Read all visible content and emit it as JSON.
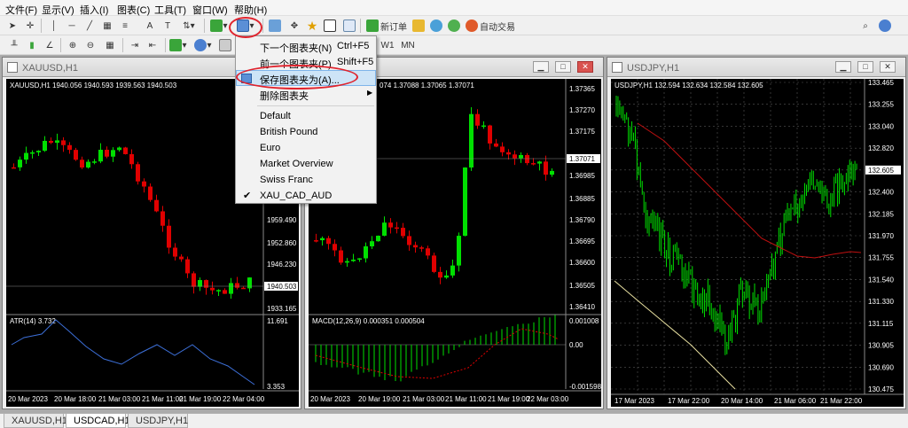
{
  "menubar": {
    "items": [
      "文件(F)",
      "显示(V)",
      "插入(I)",
      "图表(C)",
      "工具(T)",
      "窗口(W)",
      "帮助(H)"
    ]
  },
  "toolbar": {
    "new_order": "新订单",
    "auto_trade": "自动交易",
    "timeframes": [
      "W1",
      "MN"
    ]
  },
  "windows": {
    "xauusd": {
      "title": "XAUUSD,H1",
      "header": "XAUUSD,H1  1940.056 1940.593 1939.563 1940.503",
      "price_labels": [
        "1959.490",
        "1952.860",
        "1946.230",
        "1940.503",
        "1933.165"
      ],
      "indicator": "ATR(14) 3.732",
      "ind_labels": [
        "11.691",
        "3.353"
      ],
      "time_labels": [
        "20 Mar 2023",
        "20 Mar 18:00",
        "21 Mar 03:00",
        "21 Mar 11:00",
        "21 Mar 19:00",
        "22 Mar 04:00"
      ]
    },
    "usdcad": {
      "title": "USDCAD,H1",
      "header": "074 1.37088 1.37065 1.37071",
      "price_labels": [
        "1.37365",
        "1.37270",
        "1.37175",
        "1.37071",
        "1.36985",
        "1.36885",
        "1.36790",
        "1.36695",
        "1.36600",
        "1.36505",
        "1.36410"
      ],
      "indicator": "MACD(12,26,9) 0.000351 0.000504",
      "ind_labels": [
        "0.001008",
        "0.00",
        "-0.001598"
      ],
      "time_labels": [
        "20 Mar 2023",
        "20 Mar 19:00",
        "21 Mar 03:00",
        "21 Mar 11:00",
        "21 Mar 19:00",
        "22 Mar 03:00"
      ]
    },
    "usdjpy": {
      "title": "USDJPY,H1",
      "header": "USDJPY,H1  132.594 132.634 132.584 132.605",
      "price_labels": [
        "133.465",
        "133.255",
        "133.040",
        "132.820",
        "132.605",
        "132.400",
        "132.185",
        "131.970",
        "131.755",
        "131.540",
        "131.330",
        "131.115",
        "130.905",
        "130.690",
        "130.475"
      ],
      "time_labels": [
        "17 Mar 2023",
        "17 Mar 22:00",
        "20 Mar 14:00",
        "21 Mar 06:00",
        "21 Mar 22:00"
      ]
    }
  },
  "context_menu": {
    "items": [
      {
        "label": "下一个图表夹(N)",
        "shortcut": "Ctrl+F5"
      },
      {
        "label": "前一个图表夹(P)",
        "shortcut": "Shift+F5"
      },
      {
        "label": "保存图表夹为(A)...",
        "shortcut": ""
      },
      {
        "label": "删除图表夹",
        "shortcut": ""
      },
      {
        "label": "Default",
        "shortcut": ""
      },
      {
        "label": "British Pound",
        "shortcut": ""
      },
      {
        "label": "Euro",
        "shortcut": ""
      },
      {
        "label": "Market Overview",
        "shortcut": ""
      },
      {
        "label": "Swiss Franc",
        "shortcut": ""
      },
      {
        "label": "XAU_CAD_AUD",
        "shortcut": ""
      }
    ]
  },
  "tabs": [
    "XAUUSD,H1",
    "USDCAD,H1",
    "USDJPY,H1"
  ],
  "colors": {
    "bull": "#00e000",
    "bear": "#e00000",
    "atr": "#3c6fd8",
    "jpy_ma_red": "#c01010",
    "jpy_ma_yellow": "#e8e0a0",
    "highlight_oval": "#e0232d"
  }
}
